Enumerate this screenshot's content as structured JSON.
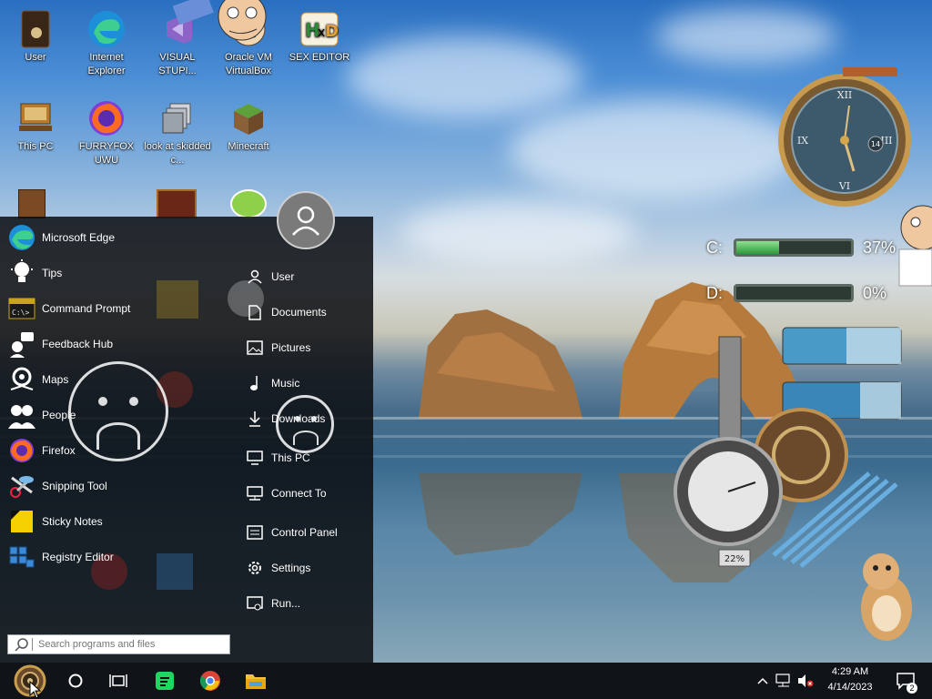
{
  "desktop": {
    "icons": [
      {
        "label": "User",
        "icon": "user-folder-icon"
      },
      {
        "label": "Internet Explorer",
        "icon": "edge-icon"
      },
      {
        "label": "VISUAL STUPI...",
        "icon": "visual-studio-icon"
      },
      {
        "label": "Oracle VM VirtualBox",
        "icon": "virtualbox-icon"
      },
      {
        "label": "SEX EDITOR",
        "icon": "hxd-icon"
      },
      {
        "label": "This PC",
        "icon": "this-pc-icon"
      },
      {
        "label": "FURRYFOX UWU",
        "icon": "firefox-icon"
      },
      {
        "label": "look at skidded c...",
        "icon": "stack-icon"
      },
      {
        "label": "Minecraft",
        "icon": "minecraft-icon"
      }
    ]
  },
  "start_menu": {
    "apps": [
      {
        "label": "Microsoft Edge",
        "icon": "edge-icon"
      },
      {
        "label": "Tips",
        "icon": "lightbulb-icon"
      },
      {
        "label": "Command Prompt",
        "icon": "cmd-icon"
      },
      {
        "label": "Feedback Hub",
        "icon": "feedback-icon"
      },
      {
        "label": "Maps",
        "icon": "maps-icon"
      },
      {
        "label": "People",
        "icon": "people-icon"
      },
      {
        "label": "Firefox",
        "icon": "firefox-icon"
      },
      {
        "label": "Snipping Tool",
        "icon": "scissors-icon"
      },
      {
        "label": "Sticky Notes",
        "icon": "sticky-note-icon"
      },
      {
        "label": "Registry Editor",
        "icon": "registry-icon"
      }
    ],
    "places": [
      {
        "label": "User",
        "icon": "user-icon"
      },
      {
        "label": "Documents",
        "icon": "document-icon"
      },
      {
        "label": "Pictures",
        "icon": "picture-icon"
      },
      {
        "label": "Music",
        "icon": "music-icon"
      },
      {
        "label": "Downloads",
        "icon": "download-icon"
      },
      {
        "label": "This PC",
        "icon": "computer-icon"
      },
      {
        "label": "Connect To",
        "icon": "connect-icon"
      },
      {
        "label": "Control Panel",
        "icon": "control-panel-icon"
      },
      {
        "label": "Settings",
        "icon": "gear-icon"
      },
      {
        "label": "Run...",
        "icon": "run-icon"
      }
    ],
    "search": {
      "placeholder": "Search programs and files"
    }
  },
  "gauges": {
    "drives": [
      {
        "label": "C:",
        "pct_text": "37%",
        "fraction": 0.37
      },
      {
        "label": "D:",
        "pct_text": "0%",
        "fraction": 0.0
      }
    ],
    "cpu_readout": "22%",
    "clock_date": "14"
  },
  "taskbar": {
    "time": "4:29 AM",
    "date": "4/14/2023",
    "notification_count": "2",
    "pinned": [
      "cortana-icon",
      "task-view-icon",
      "spotify-icon",
      "chrome-icon",
      "file-explorer-icon"
    ]
  },
  "colors": {
    "start_bg": "#0c0e12",
    "taskbar_bg": "#101418",
    "gauge_fill": "#2e9a3a"
  }
}
